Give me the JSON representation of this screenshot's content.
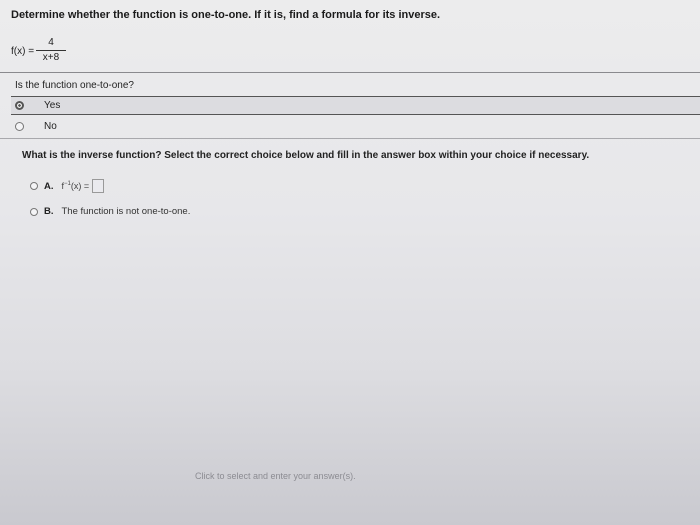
{
  "question": {
    "prompt": "Determine whether the function is one-to-one. If it is, find a formula for its inverse."
  },
  "function": {
    "lhs": "f(x) =",
    "numerator": "4",
    "denominator": "x+8"
  },
  "part1": {
    "question": "Is the function one-to-one?",
    "options": [
      {
        "label": "Yes",
        "selected": true
      },
      {
        "label": "No",
        "selected": false
      }
    ]
  },
  "part2": {
    "question": "What is the inverse function? Select the correct choice below and fill in the answer box within your choice if necessary.",
    "choices": [
      {
        "letter": "A.",
        "f": "f",
        "sup": "−1",
        "arg": "(x) =",
        "text": ""
      },
      {
        "letter": "B.",
        "text": "The function is not one-to-one."
      }
    ]
  },
  "footer": {
    "hint": "Click to select and enter your answer(s)."
  }
}
